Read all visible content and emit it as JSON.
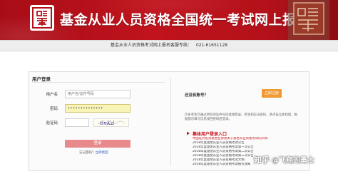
{
  "banner": {
    "title": "基金从业人员资格全国统一考试网上报名"
  },
  "servicebar": {
    "hotline_label": "基金从业人员资格考试网上报名客服专线：",
    "hotline_number": "021-61651128"
  },
  "login": {
    "title": "用户登录",
    "username_label": "用户名",
    "username_placeholder": "用户名/证件号码",
    "password_label": "密码",
    "password_value": "••••••••••••••",
    "captcha_label": "验证码",
    "captcha_value": "",
    "captcha_text": "6nKd",
    "login_button": "登录",
    "forgot_prefix": "忘记密码？",
    "forgot_link": "立即找回"
  },
  "register": {
    "question": "还没有账号？",
    "button": "立即注册"
  },
  "notes": "历史考生可通过原有的证件号码直接登录。考生如忘记密码，请点击立即找回，根据提示填写信息找回密码后登录。",
  "entry": {
    "label": "集体用户登录入口"
  },
  "news": [
    {
      "text": "中国证券投资基金业协会关于基金从业资格考试的声明",
      "color": "red"
    },
    {
      "text": "2018年度基金从业人员资格考试公告",
      "color": "normal"
    },
    {
      "text": "2018年度基金从业人员资格考试第一次公告",
      "color": "normal"
    },
    {
      "text": "2018年度基金从业人员资格考试第二次公告",
      "color": "normal"
    },
    {
      "text": "2018年度基金从业人员资格考试第三次公告",
      "color": "normal"
    },
    {
      "text": "2018年度基金从业人员资格考试大纲",
      "color": "normal"
    },
    {
      "text": "2018年度基金从业人员资格考试报名须知",
      "color": "normal"
    }
  ],
  "watermark": {
    "logo": "知乎",
    "handle": "@飞翔的勇士"
  },
  "colors": {
    "banner_red": "#c0131d",
    "login_button": "#e88a8c",
    "register_button": "#f09a33",
    "link_red": "#c5121b",
    "password_fill": "#f8f4b8"
  },
  "icons": [
    "logo-emblem-icon",
    "red-seal-icon",
    "red-arrow-icon"
  ]
}
